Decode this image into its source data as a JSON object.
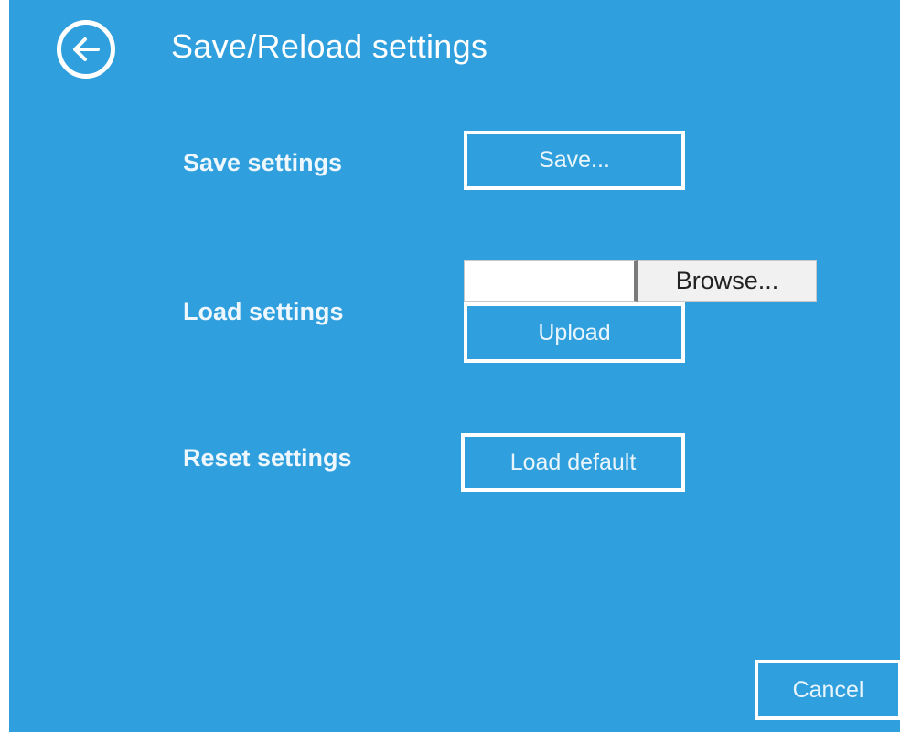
{
  "header": {
    "title": "Save/Reload settings",
    "back_icon": "back-arrow-circle-icon"
  },
  "rows": {
    "save": {
      "label": "Save settings",
      "button": "Save..."
    },
    "load": {
      "label": "Load settings",
      "file_input_value": "",
      "browse_button": "Browse...",
      "upload_button": "Upload"
    },
    "reset": {
      "label": "Reset settings",
      "button": "Load default"
    }
  },
  "footer": {
    "cancel_button": "Cancel"
  },
  "colors": {
    "background": "#2f9fdd",
    "foreground": "#ffffff"
  }
}
